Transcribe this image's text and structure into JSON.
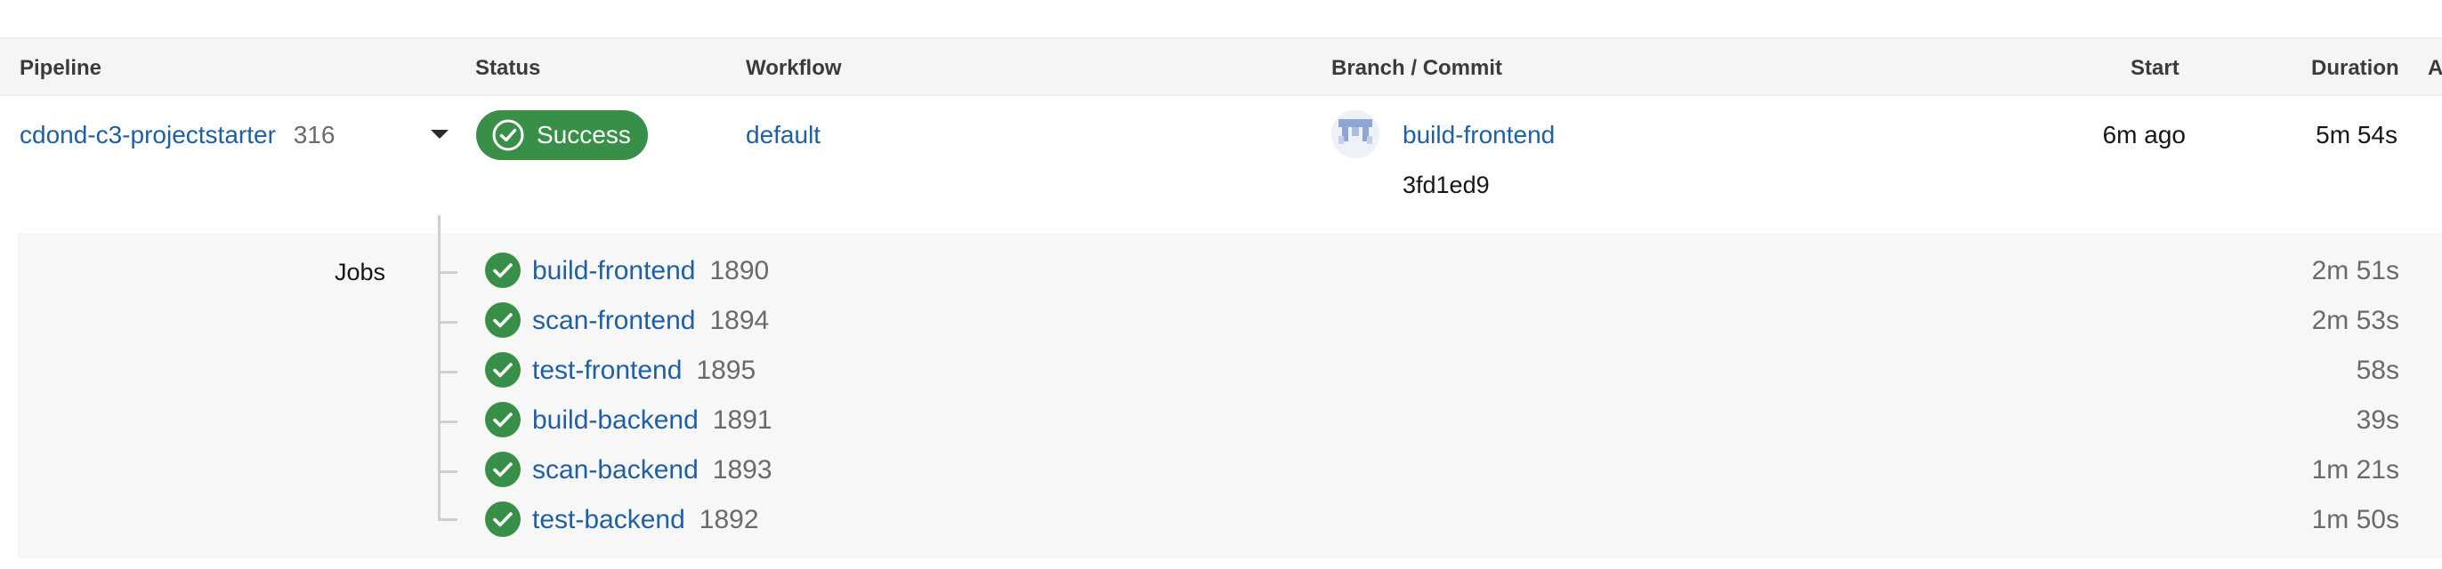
{
  "table_header": {
    "pipeline": "Pipeline",
    "status": "Status",
    "workflow": "Workflow",
    "branch_commit": "Branch / Commit",
    "start": "Start",
    "duration": "Duration",
    "actions": "A"
  },
  "pipeline_row": {
    "project": "cdond-c3-projectstarter",
    "number": "316",
    "status": "Success",
    "workflow": "default",
    "branch": "build-frontend",
    "commit": "3fd1ed9",
    "start": "6m ago",
    "duration": "5m 54s"
  },
  "jobs": {
    "label": "Jobs",
    "items": [
      {
        "name": "build-frontend",
        "number": "1890",
        "duration": "2m 51s",
        "status": "success"
      },
      {
        "name": "scan-frontend",
        "number": "1894",
        "duration": "2m 53s",
        "status": "success"
      },
      {
        "name": "test-frontend",
        "number": "1895",
        "duration": "58s",
        "status": "success"
      },
      {
        "name": "build-backend",
        "number": "1891",
        "duration": "39s",
        "status": "success"
      },
      {
        "name": "scan-backend",
        "number": "1893",
        "duration": "1m 21s",
        "status": "success"
      },
      {
        "name": "test-backend",
        "number": "1892",
        "duration": "1m 50s",
        "status": "success"
      }
    ]
  },
  "colors": {
    "success": "#389048",
    "link": "#1f5fa5",
    "header_bg": "#f5f5f5",
    "panel_bg": "#f7f7f7"
  },
  "icons": {
    "status": "check-circle-icon",
    "expand": "chevron-down-icon",
    "avatar": "identicon-avatar"
  }
}
